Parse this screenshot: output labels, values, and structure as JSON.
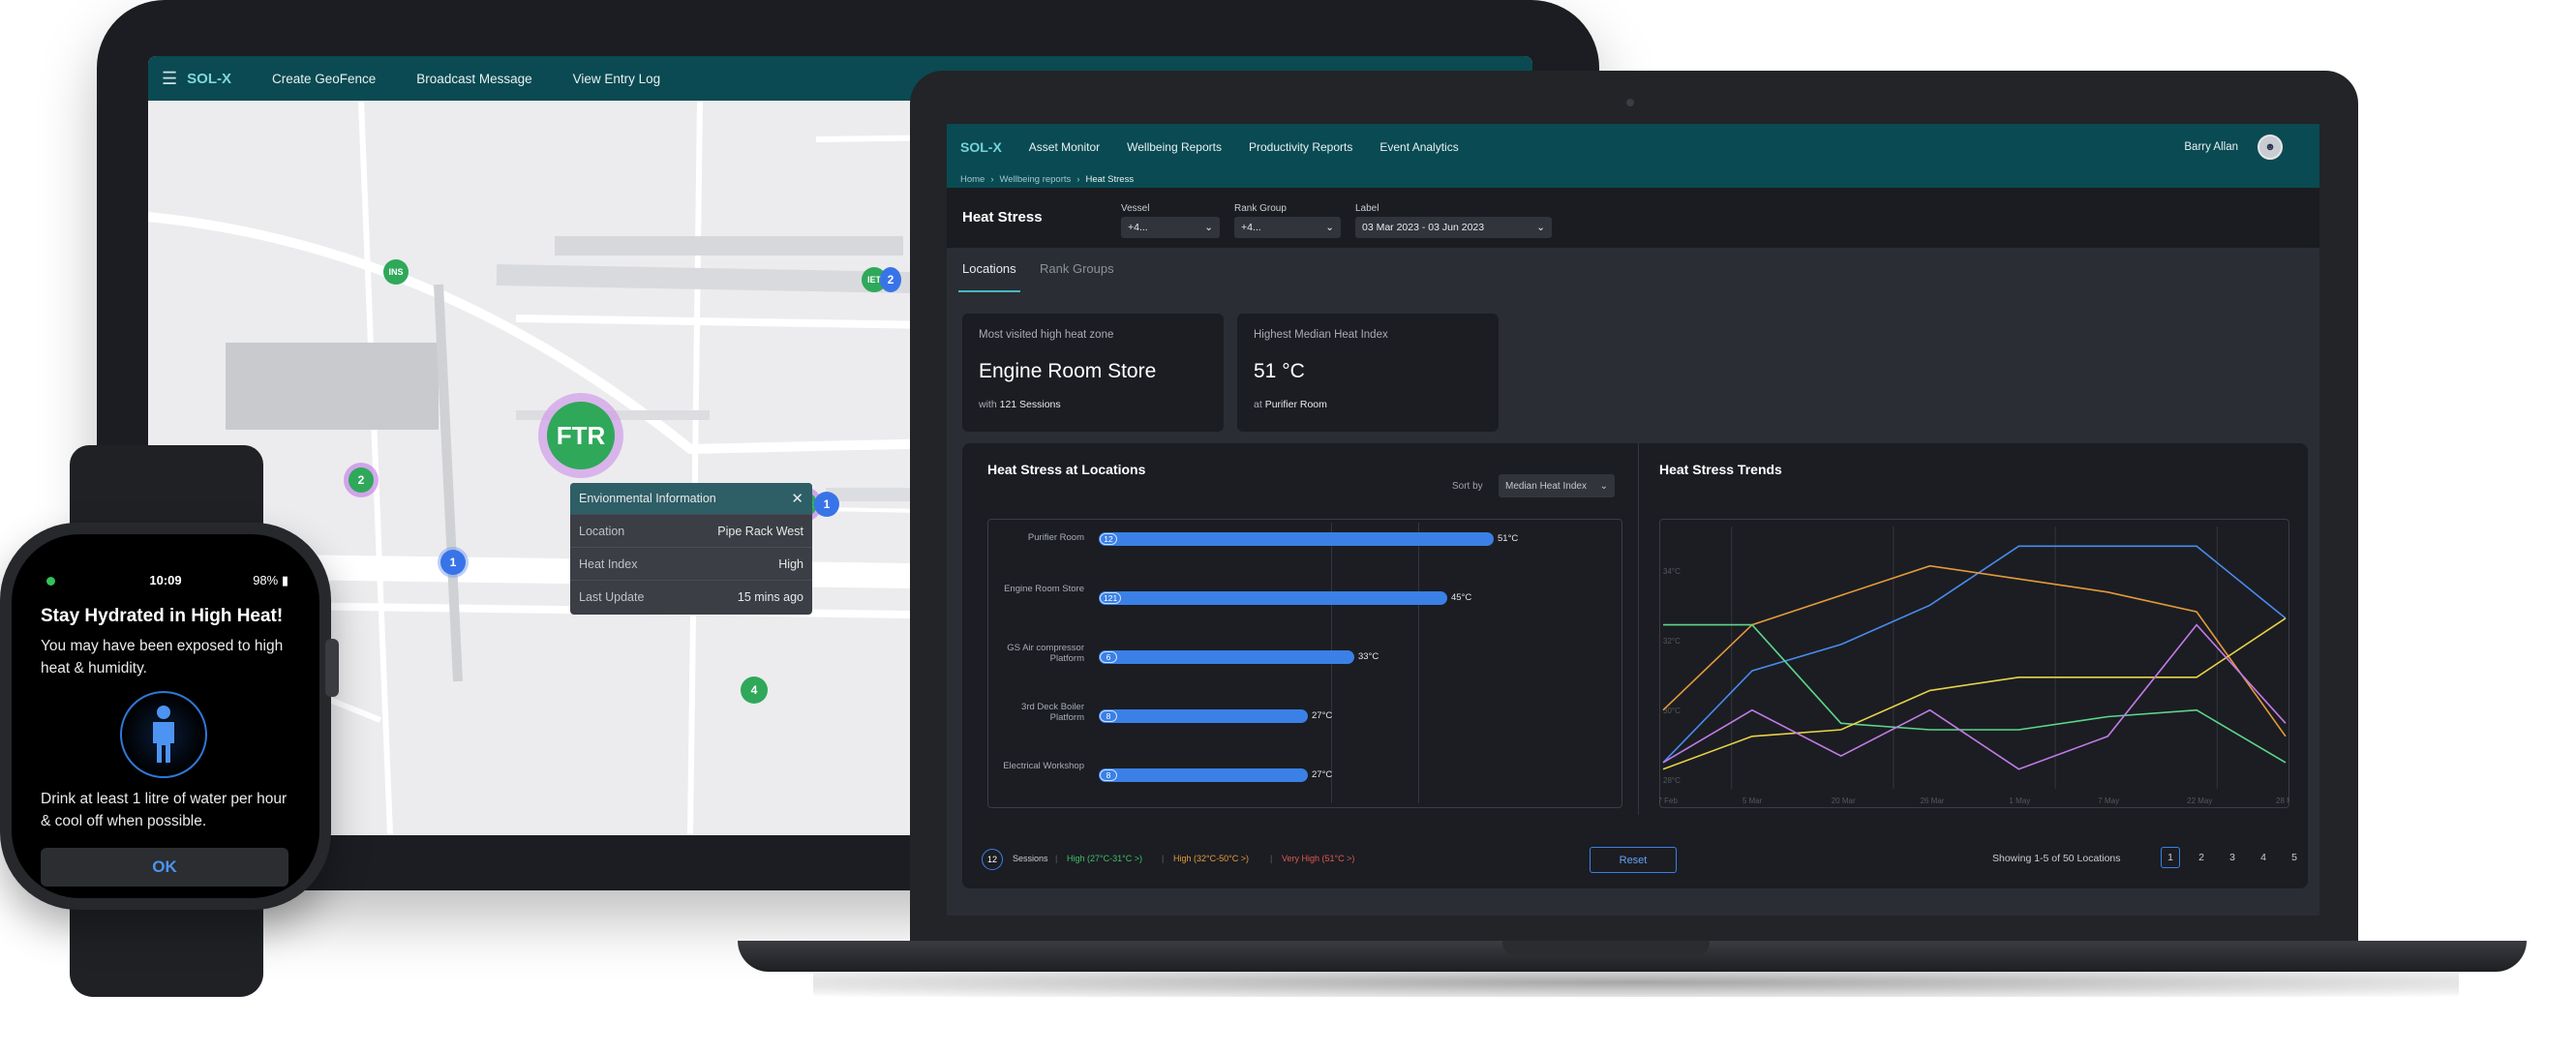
{
  "tablet": {
    "brand": "SOL-X",
    "nav": [
      "Create GeoFence",
      "Broadcast Message",
      "View Entry Log"
    ],
    "pins": [
      {
        "label": "INS",
        "color": "green"
      },
      {
        "label": "IET",
        "color": "green"
      },
      {
        "label": "2",
        "color": "blue"
      },
      {
        "label": "2",
        "color": "green"
      },
      {
        "label": "FTR",
        "color": "green"
      },
      {
        "label": "FTR",
        "color": "green"
      },
      {
        "label": "1",
        "color": "blue"
      },
      {
        "label": "1",
        "color": "blue"
      },
      {
        "label": "4",
        "color": "green"
      }
    ],
    "popup": {
      "title": "Envionmental Information",
      "rows": [
        {
          "key": "Location",
          "value": "Pipe Rack West"
        },
        {
          "key": "Heat Index",
          "value": "High"
        },
        {
          "key": "Last Update",
          "value": "15 mins ago"
        }
      ]
    }
  },
  "laptop": {
    "brand": "SOL-X",
    "nav": [
      "Asset Monitor",
      "Wellbeing Reports",
      "Productivity Reports",
      "Event Analytics"
    ],
    "user": "Barry Allan",
    "breadcrumb": [
      "Home",
      "Wellbeing reports",
      "Heat Stress"
    ],
    "page_title": "Heat Stress",
    "filters": [
      {
        "label": "Vessel",
        "value": "+4..."
      },
      {
        "label": "Rank Group",
        "value": "+4..."
      },
      {
        "label": "Label",
        "value": "03 Mar 2023  - 03 Jun 2023"
      }
    ],
    "tabs": [
      "Locations",
      "Rank Groups"
    ],
    "cards": [
      {
        "label": "Most visited high heat zone",
        "value": "Engine Room Store",
        "sub_prefix": "with",
        "sub_value": "121 Sessions"
      },
      {
        "label": "Highest Median Heat Index",
        "value": "51 °C",
        "sub_prefix": "at",
        "sub_value": "Purifier Room"
      }
    ],
    "bar_panel": {
      "title": "Heat Stress at Locations",
      "sort_label": "Sort by",
      "sort_value": "Median Heat Index"
    },
    "trend_panel": {
      "title": "Heat Stress Trends"
    },
    "legend": {
      "badge": "12",
      "sessions": "Sessions",
      "items": [
        {
          "text": "High (27°C-31°C >)",
          "color": "#3fbf6a"
        },
        {
          "text": "High (32°C-50°C >)",
          "color": "#e59a3a"
        },
        {
          "text": "Very High (51°C >)",
          "color": "#e0574f"
        }
      ]
    },
    "reset": "Reset",
    "showing": "Showing 1-5 of 50 Locations",
    "pages": [
      "1",
      "2",
      "3",
      "4",
      "5"
    ]
  },
  "chart_data": [
    {
      "type": "bar",
      "title": "Heat Stress at Locations",
      "categories": [
        "Purifier Room",
        "Engine Room Store",
        "GS Air compressor Platform",
        "3rd Deck Boiler Platform",
        "Electrical Workshop"
      ],
      "values": [
        51,
        45,
        33,
        27,
        27
      ],
      "sessions": [
        12,
        121,
        6,
        8,
        8
      ],
      "value_labels": [
        "51°C",
        "45°C",
        "33°C",
        "27°C",
        "27°C"
      ],
      "xlim": [
        0,
        60
      ]
    },
    {
      "type": "line",
      "title": "Heat Stress Trends",
      "x": [
        "27 Feb",
        "5 Mar",
        "20 Mar",
        "26 Mar",
        "1 May",
        "7 May",
        "22 May",
        "28 May"
      ],
      "ylabels": [
        "28°C",
        "30°C",
        "32°C",
        "34°C"
      ],
      "series": [
        {
          "color": "#4a8bf0",
          "values": [
            4,
            18,
            22,
            28,
            37,
            37,
            37,
            26
          ]
        },
        {
          "color": "#e59a3a",
          "values": [
            12,
            25,
            null,
            34,
            32,
            30,
            27,
            8
          ]
        },
        {
          "color": "#5ed68a",
          "values": [
            25,
            25,
            10,
            9,
            9,
            11,
            12,
            4
          ]
        },
        {
          "color": "#e8d24a",
          "values": [
            3,
            8,
            9,
            15,
            17,
            17,
            17,
            26
          ]
        },
        {
          "color": "#c27be8",
          "values": [
            4,
            12,
            5,
            12,
            3,
            8,
            25,
            10
          ]
        }
      ]
    }
  ],
  "watch": {
    "time": "10:09",
    "battery": "98%",
    "title": "Stay Hydrated in High Heat!",
    "message": "You may have been exposed to high heat & humidity.",
    "advice": "Drink at least 1 litre of water per hour & cool off when possible.",
    "ok": "OK"
  }
}
